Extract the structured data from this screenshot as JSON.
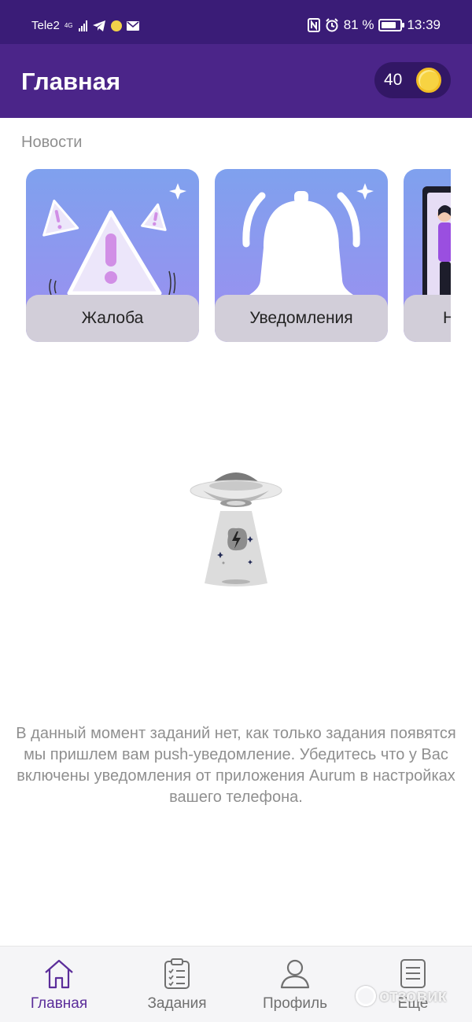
{
  "status_bar": {
    "carrier": "Tele2",
    "network_type": "4G",
    "battery_percent": "81 %",
    "battery_level": 0.81,
    "time": "13:39",
    "icons": [
      "signal-icon",
      "telegram-icon",
      "emoji-icon",
      "mail-icon",
      "nfc-icon",
      "alarm-icon",
      "battery-icon"
    ]
  },
  "header": {
    "title": "Главная",
    "coin_balance": "40",
    "coin_color": "#f7d342"
  },
  "news": {
    "section_title": "Новости",
    "cards": [
      {
        "label": "Жалоба",
        "icon": "warning-icon"
      },
      {
        "label": "Уведомления",
        "icon": "bell-icon"
      },
      {
        "label": "Н",
        "icon": "person-icon"
      }
    ]
  },
  "empty_state": {
    "icon": "ufo-icon",
    "message": "В данный момент заданий нет, как только задания появятся мы пришлем вам push-уведомление. Убедитесь что у Вас включены уведомления от приложения Aurum в настройках вашего телефона."
  },
  "bottom_nav": {
    "items": [
      {
        "label": "Главная",
        "icon": "home-icon",
        "active": true
      },
      {
        "label": "Задания",
        "icon": "clipboard-icon",
        "active": false
      },
      {
        "label": "Профиль",
        "icon": "profile-icon",
        "active": false
      },
      {
        "label": "Еще",
        "icon": "more-icon",
        "active": false
      }
    ]
  },
  "watermark": {
    "text": "отзовик"
  },
  "colors": {
    "status_bar": "#3a1c77",
    "app_bar": "#4b2589",
    "accent": "#5b2d9a",
    "card_label_bg": "#d2ced9",
    "secondary_text": "#8f8f8f"
  }
}
